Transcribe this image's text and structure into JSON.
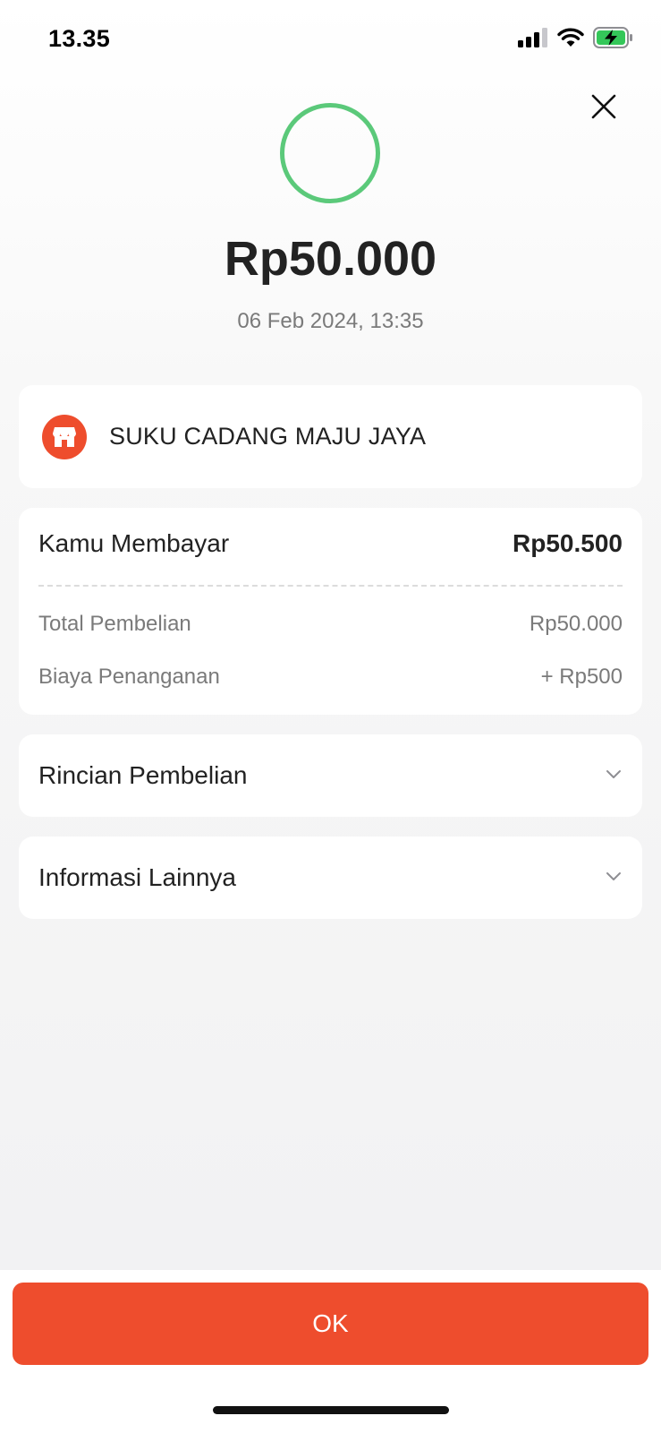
{
  "status_bar": {
    "time": "13.35",
    "icons": [
      "cellular-signal-icon",
      "wifi-icon",
      "battery-charging-icon"
    ]
  },
  "header": {
    "close_icon": "close-icon",
    "status_indicator": "success-ring-icon",
    "amount": "Rp50.000",
    "datetime": "06 Feb 2024, 13:35"
  },
  "merchant": {
    "icon": "store-icon",
    "name": "SUKU CADANG MAJU JAYA"
  },
  "payment": {
    "label": "Kamu Membayar",
    "total": "Rp50.500",
    "items": [
      {
        "label": "Total Pembelian",
        "value": "Rp50.000"
      },
      {
        "label": "Biaya Penanganan",
        "value": "+ Rp500"
      }
    ]
  },
  "sections": [
    {
      "label": "Rincian Pembelian",
      "icon": "chevron-down-icon"
    },
    {
      "label": "Informasi Lainnya",
      "icon": "chevron-down-icon"
    }
  ],
  "footer": {
    "ok_label": "OK"
  },
  "colors": {
    "accent": "#ee4d2d",
    "success": "#5bc97a"
  }
}
